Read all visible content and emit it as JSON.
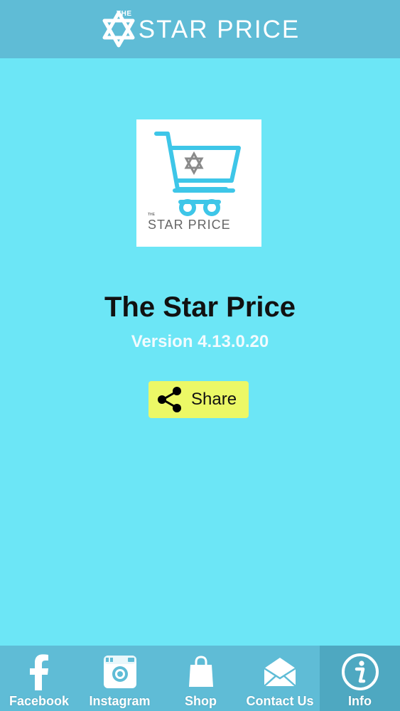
{
  "header": {
    "logo_small": "THE",
    "logo_title": "STAR PRICE"
  },
  "main": {
    "logo_card": {
      "small_text": "THE",
      "text": "STAR PRICE"
    },
    "app_name": "The Star Price",
    "version": "Version 4.13.0.20",
    "share_label": "Share"
  },
  "bottom_nav": {
    "items": [
      {
        "label": "Facebook",
        "icon": "facebook-icon"
      },
      {
        "label": "Instagram",
        "icon": "instagram-icon"
      },
      {
        "label": "Shop",
        "icon": "shopping-bag-icon"
      },
      {
        "label": "Contact Us",
        "icon": "envelope-icon"
      },
      {
        "label": "Info",
        "icon": "info-icon"
      }
    ],
    "active_index": 4
  },
  "colors": {
    "background": "#6ce6f6",
    "header": "#5fbcd6",
    "nav_active": "#4ea8c1",
    "share_button": "#ecf866",
    "cart_accent": "#3ec6e8"
  }
}
